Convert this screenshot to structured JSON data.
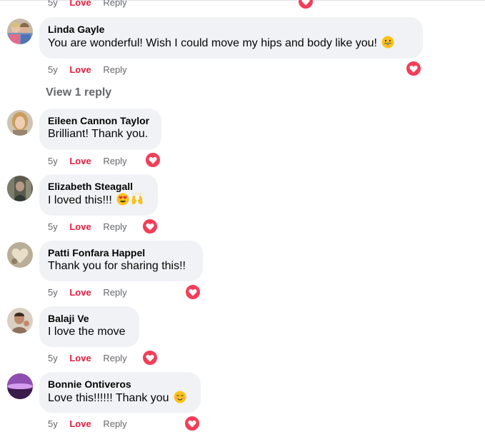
{
  "labels": {
    "love": "Love",
    "reply": "Reply"
  },
  "partial_top": {
    "age": "5y"
  },
  "view_replies": "View 1 reply",
  "comments": [
    {
      "author": "Linda Gayle",
      "text": "You are wonderful! Wish I could move my hips and body like you!",
      "age": "5y",
      "emoji": [
        "grinning-face-emoji"
      ]
    },
    {
      "author": "Eileen Cannon Taylor",
      "text": "Brilliant! Thank you.",
      "age": "5y",
      "emoji": []
    },
    {
      "author": "Elizabeth Steagall",
      "text": "I loved this!!!",
      "age": "5y",
      "emoji": [
        "heart-eyes-emoji",
        "raising-hands-emoji"
      ]
    },
    {
      "author": "Patti Fonfara Happel",
      "text": "Thank you for sharing this!!",
      "age": "5y",
      "emoji": []
    },
    {
      "author": "Balaji Ve",
      "text": "I love the move",
      "age": "5y",
      "emoji": []
    },
    {
      "author": "Bonnie Ontiveros",
      "text": "Love this!!!!!! Thank you",
      "age": "5y",
      "emoji": [
        "blushing-face-emoji"
      ]
    }
  ],
  "partial_bottom": {
    "age": "5y"
  },
  "colors": {
    "love": "#e41e3f",
    "heart": "#f33e58",
    "bubble": "#f0f2f5",
    "meta": "#65676b"
  }
}
